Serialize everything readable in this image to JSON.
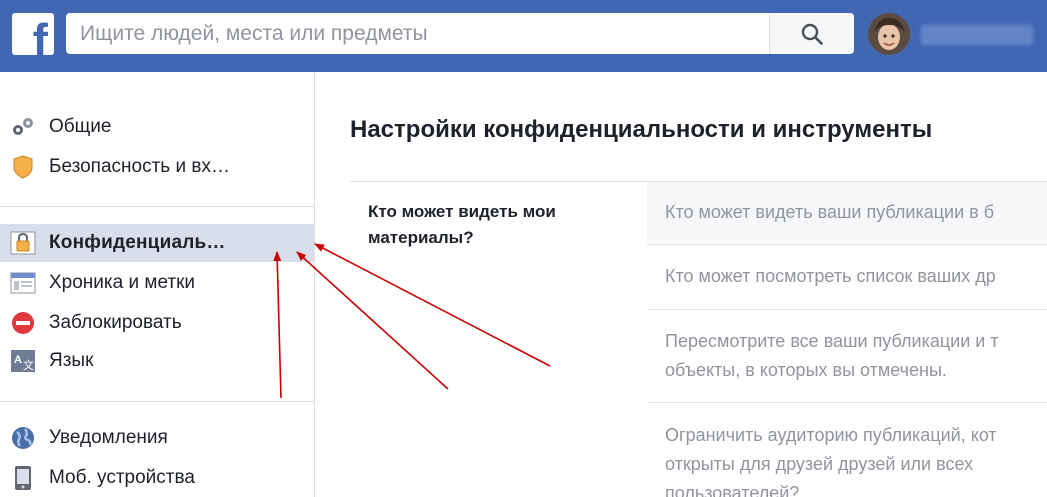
{
  "header": {
    "logo_letter": "f",
    "search": {
      "placeholder": "Ищите людей, места или предметы",
      "value": ""
    }
  },
  "sidebar": {
    "groups": [
      {
        "items": [
          {
            "label": "Общие",
            "icon": "gears-icon"
          },
          {
            "label": "Безопасность и вх…",
            "icon": "shield-icon"
          }
        ]
      },
      {
        "items": [
          {
            "label": "Конфиденциаль…",
            "icon": "lock-icon",
            "active": true
          },
          {
            "label": "Хроника и метки",
            "icon": "timeline-icon"
          },
          {
            "label": "Заблокировать",
            "icon": "block-icon"
          },
          {
            "label": "Язык",
            "icon": "language-icon"
          }
        ]
      },
      {
        "items": [
          {
            "label": "Уведомления",
            "icon": "globe-icon"
          },
          {
            "label": "Моб. устройства",
            "icon": "phone-icon"
          }
        ]
      }
    ]
  },
  "main": {
    "title": "Настройки конфиденциальности и инструменты",
    "section": {
      "heading_line1": "Кто может видеть мои",
      "heading_line2": "материалы?",
      "rows": [
        {
          "lines": [
            "Кто может видеть ваши публикации в б"
          ]
        },
        {
          "lines": [
            "Кто может посмотреть список ваших др"
          ]
        },
        {
          "lines": [
            "Пересмотрите все ваши публикации и т",
            "объекты, в которых вы отмечены."
          ]
        },
        {
          "lines": [
            "Ограничить аудиторию публикаций, кот",
            "открыты для друзей друзей или всех",
            "пользователей?"
          ]
        }
      ]
    }
  },
  "colors": {
    "brand_blue": "#4267b2",
    "active_bg": "#d8dfea",
    "annotation_arrow": "#cc0000",
    "muted_text": "#90949c"
  }
}
